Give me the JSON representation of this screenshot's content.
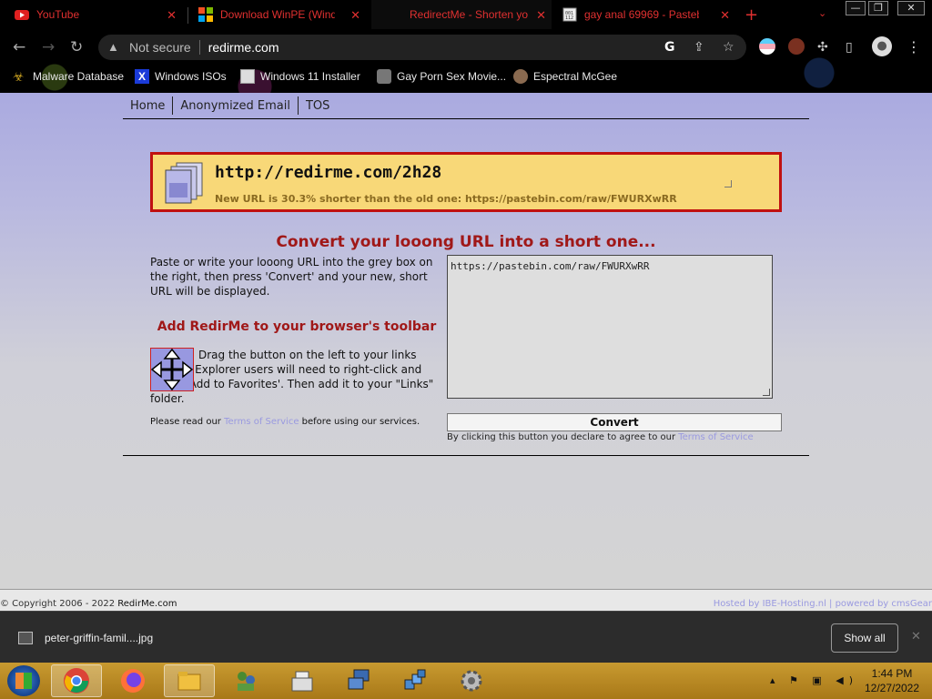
{
  "browser": {
    "tabs": [
      {
        "title": "YouTube",
        "icon": "youtube-icon"
      },
      {
        "title": "Download WinPE (Window",
        "icon": "microsoft-icon"
      },
      {
        "title": "RedirectMe - Shorten yo",
        "icon": "redirme-icon"
      },
      {
        "title": "gay anal 69969 - Pasteb",
        "icon": "pastebin-icon"
      }
    ],
    "new_tab": "+",
    "tab_search": "⌄",
    "window_controls": {
      "minimize": "—",
      "maximize": "❐",
      "close": "✕"
    },
    "omnibox": {
      "security": "Not secure",
      "host": "redirme.com"
    },
    "bookmarks": [
      {
        "label": "Malware Database",
        "icon": "biohazard-icon"
      },
      {
        "label": "Windows ISOs",
        "icon": "x-icon"
      },
      {
        "label": "Windows 11 Installer",
        "icon": "page-icon"
      },
      {
        "label": "Gay Porn Sex Movie...",
        "icon": "site-icon"
      },
      {
        "label": "Espectral McGee",
        "icon": "avatar-icon"
      }
    ]
  },
  "page": {
    "nav": [
      "Home",
      "Anonymized Email",
      "TOS"
    ],
    "result": {
      "short_url": "http://redirme.com/2h28",
      "note": "New URL is 30.3% shorter than the old one: https://pastebin.com/raw/FWURXwRR"
    },
    "headline": "Convert your looong URL into a short one...",
    "instructions": "Paste or write your looong URL into the grey box on the right, then press 'Convert' and your new, short URL will be displayed.",
    "toolbar_heading": "Add RedirMe to your browser's toolbar",
    "drag_text": "Drag the button on the left to your links toolbar. Explorer users will need to right-click and select 'Add to Favorites'. Then add it to your \"Links\" folder.",
    "read_tos": {
      "before": "Please read our ",
      "link": "Terms of Service",
      "after": " before using our services."
    },
    "url_input": "https://pastebin.com/raw/FWURXwRR",
    "convert_label": "Convert",
    "agree": {
      "before": "By clicking this button you declare to agree to our ",
      "link": "Terms of Service"
    }
  },
  "footer": {
    "copyright_prefix": "© Copyright 2006 - 2022 ",
    "brand": "RedirMe.com",
    "hosted": "Hosted by IBE-Hosting.nl | powered by cmsGear"
  },
  "downloads": {
    "file": "peter-griffin-famil....jpg",
    "show_all": "Show all"
  },
  "taskbar": {
    "apps": [
      "chrome-icon",
      "firefox-icon",
      "file-explorer-icon",
      "network-icon",
      "cash-register-icon",
      "remote-desktop-icon",
      "cubes-icon",
      "settings-gear-icon"
    ],
    "tray": "▴ ⚑ ▣ ◀)",
    "time": "1:44 PM",
    "date": "12/27/2022"
  },
  "colors": {
    "headline_red": "#a01818",
    "result_bg": "#f8d878",
    "result_border": "#c01010",
    "tab_text": "#e03030",
    "link_lavender": "#9a9ae0"
  }
}
